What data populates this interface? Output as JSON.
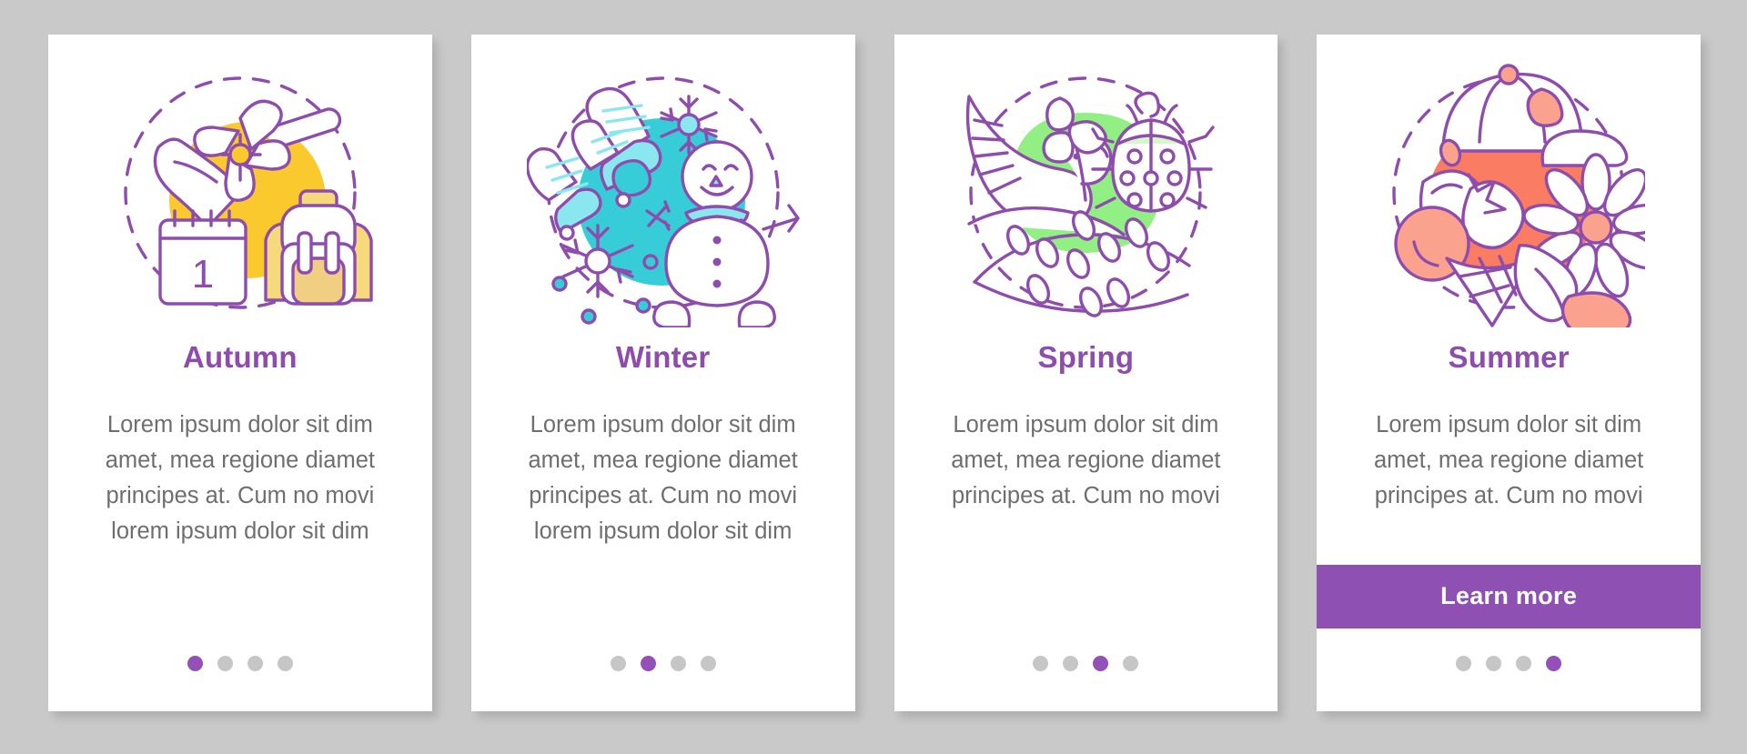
{
  "theme": {
    "page_background": "#c9c9c9",
    "card_background": "#ffffff",
    "title_color": "#8e4cad",
    "body_color": "#6e6e6e",
    "accent": "#8e51b3",
    "dot_inactive": "#c6c6c6",
    "dot_active": "#9250b8"
  },
  "cards": [
    {
      "id": "autumn",
      "illustration": "autumn-school-illustration",
      "blob_color": "#fac92e",
      "title": "Autumn",
      "body": "Lorem ipsum dolor sit dim amet, mea regione diamet principes at. Cum no movi lorem ipsum dolor sit dim",
      "cta": null,
      "dots": {
        "count": 4,
        "active_index": 0
      }
    },
    {
      "id": "winter",
      "illustration": "winter-snowman-illustration",
      "blob_color": "#37cdd8",
      "title": "Winter",
      "body": "Lorem ipsum dolor sit dim amet, mea regione diamet principes at. Cum no movi lorem ipsum dolor sit dim",
      "cta": null,
      "dots": {
        "count": 4,
        "active_index": 1
      }
    },
    {
      "id": "spring",
      "illustration": "spring-dove-illustration",
      "blob_color": "#92ef84",
      "title": "Spring",
      "body": "Lorem ipsum dolor sit dim amet, mea regione diamet principes at. Cum no movi",
      "cta": null,
      "dots": {
        "count": 4,
        "active_index": 2
      }
    },
    {
      "id": "summer",
      "illustration": "summer-icecream-illustration",
      "blob_color": "#fa7d63",
      "title": "Summer",
      "body": "Lorem ipsum dolor sit dim amet, mea regione diamet principes at. Cum no movi",
      "cta": "Learn more",
      "dots": {
        "count": 4,
        "active_index": 3
      }
    }
  ]
}
